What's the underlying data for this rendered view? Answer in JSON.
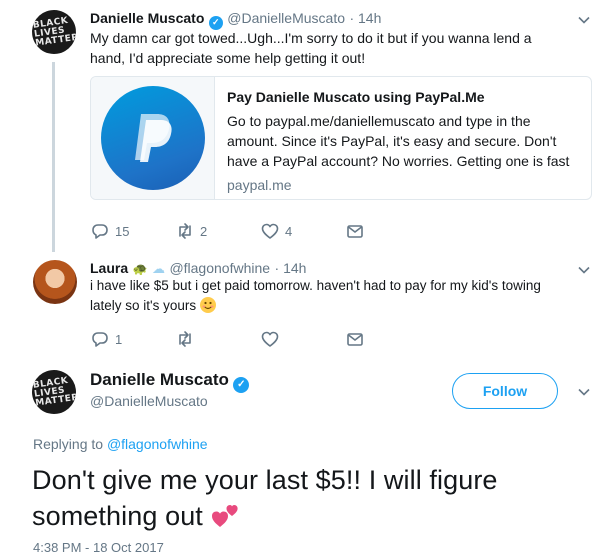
{
  "tweet1": {
    "name": "Danielle Muscato",
    "handle": "@DanielleMuscato",
    "time": "· 14h",
    "text_line1": "My damn car got towed...Ugh...I'm sorry to do it but if you wanna lend a",
    "text_line2": "hand, I'd appreciate some help getting it out!",
    "card": {
      "title": "Pay Danielle Muscato using PayPal.Me",
      "desc_line1": "Go to paypal.me/daniellemuscato and type in the",
      "desc_line2": "amount. Since it's PayPal, it's easy and secure. Don't",
      "desc_line3": "have a PayPal account? No worries. Getting one is fast",
      "domain": "paypal.me"
    },
    "reply_count": "15",
    "retweet_count": "2",
    "like_count": "4"
  },
  "tweet2": {
    "name": "Laura",
    "handle": "@flagonofwhine",
    "time": "· 14h",
    "text_line1": "i have like $5 but i get paid tomorrow. haven't had to pay for my kid's towing",
    "text_line2": "lately so it's yours",
    "reply_count": "1"
  },
  "main_tweet": {
    "name": "Danielle Muscato",
    "handle": "@DanielleMuscato",
    "follow_label": "Follow",
    "replying_prefix": "Replying to",
    "replying_handle": "@flagonofwhine",
    "text_line1": "Don't give me your last $5!! I will figure",
    "text_line2": "something out",
    "timestamp": "4:38 PM - 18 Oct 2017"
  },
  "avatar_text": [
    "BLACK",
    "LIVES",
    "MATTER"
  ],
  "colors": {
    "accent": "#1da1f2",
    "muted": "#657786",
    "text": "#14171a",
    "border": "#e1e8ed",
    "heart_emoji": "#e84a7e"
  },
  "icons": [
    "verified-icon",
    "reply-icon",
    "retweet-icon",
    "like-icon",
    "dm-icon",
    "chevron-down-icon",
    "paypal-logo-icon",
    "turtle-emoji-icon",
    "cloud-emoji-icon",
    "smile-emoji-icon",
    "two-hearts-emoji-icon"
  ]
}
